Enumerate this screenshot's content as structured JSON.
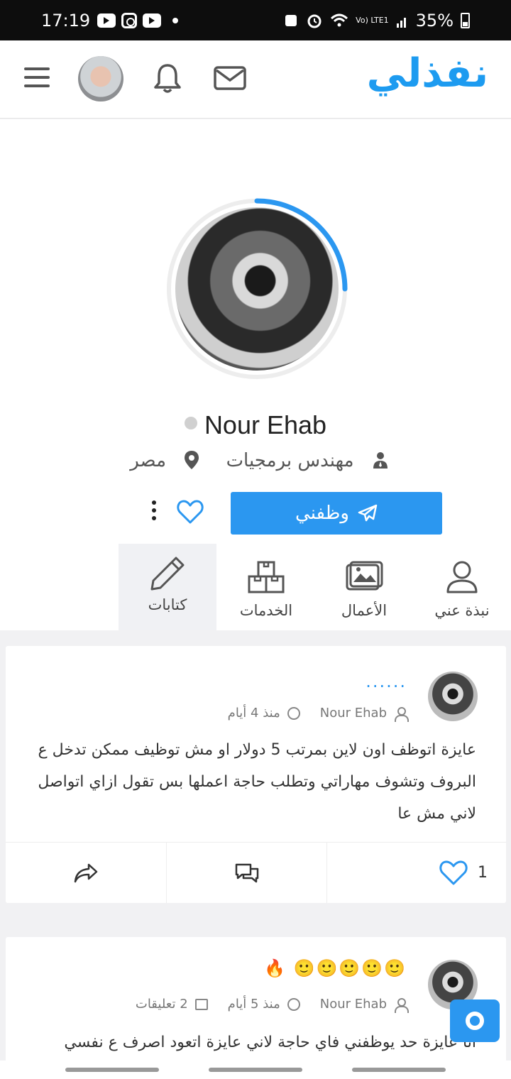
{
  "status_bar": {
    "time": "17:19",
    "battery": "35%",
    "network": "Vo) LTE1",
    "icons": [
      "youtube-icon",
      "instagram-icon",
      "youtube-icon",
      "dot-icon",
      "upload-icon",
      "alarm-icon",
      "wifi-icon",
      "signal-icon",
      "battery-icon"
    ]
  },
  "header": {
    "logo": "نفذلي",
    "icons": [
      "hamburger-icon",
      "avatar",
      "bell-icon",
      "mail-icon"
    ],
    "brand_color": "#1d9bf0"
  },
  "profile": {
    "name": "Nour Ehab",
    "online": false,
    "job_title": "مهندس برمجيات",
    "location": "مصر",
    "progress": 0.25,
    "hire_label": "وظفني",
    "accent_color": "#2b97f0"
  },
  "tabs": [
    {
      "label": "نبذة عني",
      "icon": "user-icon",
      "active": false
    },
    {
      "label": "الأعمال",
      "icon": "gallery-icon",
      "active": false
    },
    {
      "label": "الخدمات",
      "icon": "boxes-icon",
      "active": false
    },
    {
      "label": "كتابات",
      "icon": "pencil-icon",
      "active": true
    }
  ],
  "posts": [
    {
      "title": "......",
      "author": "Nour Ehab",
      "time": "منذ 4 أيام",
      "body": "عايزة اتوظف اون لاين بمرتب 5 دولار او مش توظيف ممكن تدخل ع البروف وتشوف مهاراتي وتطلب حاجة اعملها بس تقول ازاي اتواصل لاني مش عا",
      "likes": "1"
    },
    {
      "title": "🙂🙂🙂🙂🙂",
      "title_icon": "fire-icon",
      "author": "Nour Ehab",
      "time": "منذ 5 أيام",
      "comments": "2 تعليقات",
      "body": "انا عايزة حد يوظفني فاي حاجة لاني عايزة اتعود اصرف ع نفسي"
    }
  ]
}
